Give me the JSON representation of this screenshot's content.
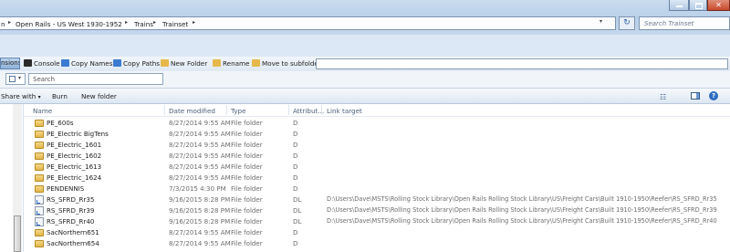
{
  "address": {
    "prefix_crumb": "n",
    "crumbs": [
      "Open Rails - US West 1930-1952",
      "Trains",
      "Trainset"
    ],
    "separator": "▸",
    "dropdown": "▾",
    "refresh": "↻",
    "search_placeholder": "Search Trainset"
  },
  "window": {
    "close": "✕"
  },
  "plugin_toolbar": {
    "extensions_tab": "nsions",
    "items": [
      {
        "label": "Console",
        "icon": "console-icon",
        "color": "#2b2b2b"
      },
      {
        "label": "Copy Names",
        "icon": "copy-names-icon",
        "color": "#3b7bd1"
      },
      {
        "label": "Copy Paths",
        "icon": "copy-paths-icon",
        "color": "#3b7bd1"
      },
      {
        "label": "New Folder",
        "icon": "new-folder-icon",
        "color": "#e6b84a"
      },
      {
        "label": "Rename",
        "icon": "rename-icon",
        "color": "#e6b84a"
      },
      {
        "label": "Move to subfolder",
        "icon": "move-subfolder-icon",
        "color": "#e6b84a"
      }
    ]
  },
  "inner_search": {
    "placeholder": "Search"
  },
  "command_bar": {
    "share_with": "Share with",
    "share_arrow": "▾",
    "burn": "Burn",
    "new_folder": "New folder",
    "views_icon": "☷",
    "help": "?"
  },
  "columns": {
    "name": "Name",
    "date_modified": "Date modified",
    "type": "Type",
    "attributes": "Attribut...",
    "link_target": "Link target"
  },
  "rows": [
    {
      "name": "PE_600s",
      "date": "8/27/2014 9:55 AM",
      "type": "File folder",
      "attr": "D",
      "link": "",
      "kind": "folder"
    },
    {
      "name": "PE_Electric BigTens",
      "date": "8/27/2014 9:55 AM",
      "type": "File folder",
      "attr": "D",
      "link": "",
      "kind": "folder"
    },
    {
      "name": "PE_Electric_1601",
      "date": "8/27/2014 9:55 AM",
      "type": "File folder",
      "attr": "D",
      "link": "",
      "kind": "folder"
    },
    {
      "name": "PE_Electric_1602",
      "date": "8/27/2014 9:55 AM",
      "type": "File folder",
      "attr": "D",
      "link": "",
      "kind": "folder"
    },
    {
      "name": "PE_Electric_1613",
      "date": "8/27/2014 9:55 AM",
      "type": "File folder",
      "attr": "D",
      "link": "",
      "kind": "folder"
    },
    {
      "name": "PE_Electric_1624",
      "date": "8/27/2014 9:55 AM",
      "type": "File folder",
      "attr": "D",
      "link": "",
      "kind": "folder"
    },
    {
      "name": "PENDENNIS",
      "date": "7/3/2015 4:30 PM",
      "type": "File folder",
      "attr": "D",
      "link": "",
      "kind": "folder"
    },
    {
      "name": "RS_SFRD_Rr35",
      "date": "9/16/2015 8:28 PM",
      "type": "File folder",
      "attr": "DL",
      "link": "D:\\Users\\Dave\\MSTS\\Rolling Stock Library\\Open Rails Rolling Stock Library\\US\\Freight Cars\\Built 1910-1950\\Reefer\\RS_SFRD_Rr35",
      "kind": "link"
    },
    {
      "name": "RS_SFRD_Rr39",
      "date": "9/16/2015 8:28 PM",
      "type": "File folder",
      "attr": "DL",
      "link": "D:\\Users\\Dave\\MSTS\\Rolling Stock Library\\Open Rails Rolling Stock Library\\US\\Freight Cars\\Built 1910-1950\\Reefer\\RS_SFRD_Rr39",
      "kind": "link"
    },
    {
      "name": "RS_SFRD_Rr40",
      "date": "9/16/2015 8:28 PM",
      "type": "File folder",
      "attr": "DL",
      "link": "D:\\Users\\Dave\\MSTS\\Rolling Stock Library\\Open Rails Rolling Stock Library\\US\\Freight Cars\\Built 1910-1950\\Reefer\\RS_SFRD_Rr40",
      "kind": "link"
    },
    {
      "name": "SacNorthern651",
      "date": "8/27/2014 9:55 AM",
      "type": "File folder",
      "attr": "D",
      "link": "",
      "kind": "folder"
    },
    {
      "name": "SacNorthern654",
      "date": "8/27/2014 9:55 AM",
      "type": "File folder",
      "attr": "D",
      "link": "",
      "kind": "folder"
    }
  ]
}
